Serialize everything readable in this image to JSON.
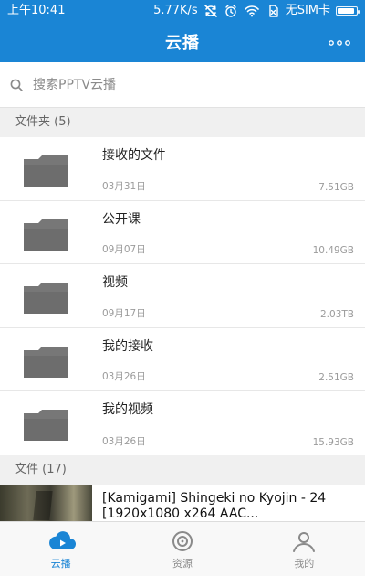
{
  "status_bar": {
    "time": "上午10:41",
    "network_speed": "5.77K/s",
    "sim_status": "无SIM卡",
    "icons": {
      "sync": "sync-off-icon",
      "alarm": "alarm-icon",
      "wifi": "wifi-icon",
      "sim": "sim-icon",
      "battery": "battery-icon"
    },
    "battery_level": 0.9
  },
  "header": {
    "title": "云播",
    "more_icon": "more-icon"
  },
  "search": {
    "placeholder": "搜索PPTV云播",
    "value": "",
    "icon": "search-icon"
  },
  "sections": {
    "folders_title": "文件夹 (5)",
    "files_title": "文件 (17)"
  },
  "folders": [
    {
      "name": "接收的文件",
      "date": "03月31日",
      "size": "7.51GB"
    },
    {
      "name": "公开课",
      "date": "09月07日",
      "size": "10.49GB"
    },
    {
      "name": "视频",
      "date": "09月17日",
      "size": "2.03TB"
    },
    {
      "name": "我的接收",
      "date": "03月26日",
      "size": "2.51GB"
    },
    {
      "name": "我的视频",
      "date": "03月26日",
      "size": "15.93GB"
    }
  ],
  "files": [
    {
      "title": "[Kamigami] Shingeki no Kyojin - 24 [1920x1080 x264 AAC..."
    }
  ],
  "bottom_nav": {
    "items": [
      {
        "label": "云播",
        "icon": "cloud-play-icon",
        "active": true
      },
      {
        "label": "资源",
        "icon": "resource-icon",
        "active": false
      },
      {
        "label": "我的",
        "icon": "user-icon",
        "active": false
      }
    ]
  },
  "colors": {
    "brand_blue": "#1a85d5",
    "folder_gray": "#777777"
  }
}
